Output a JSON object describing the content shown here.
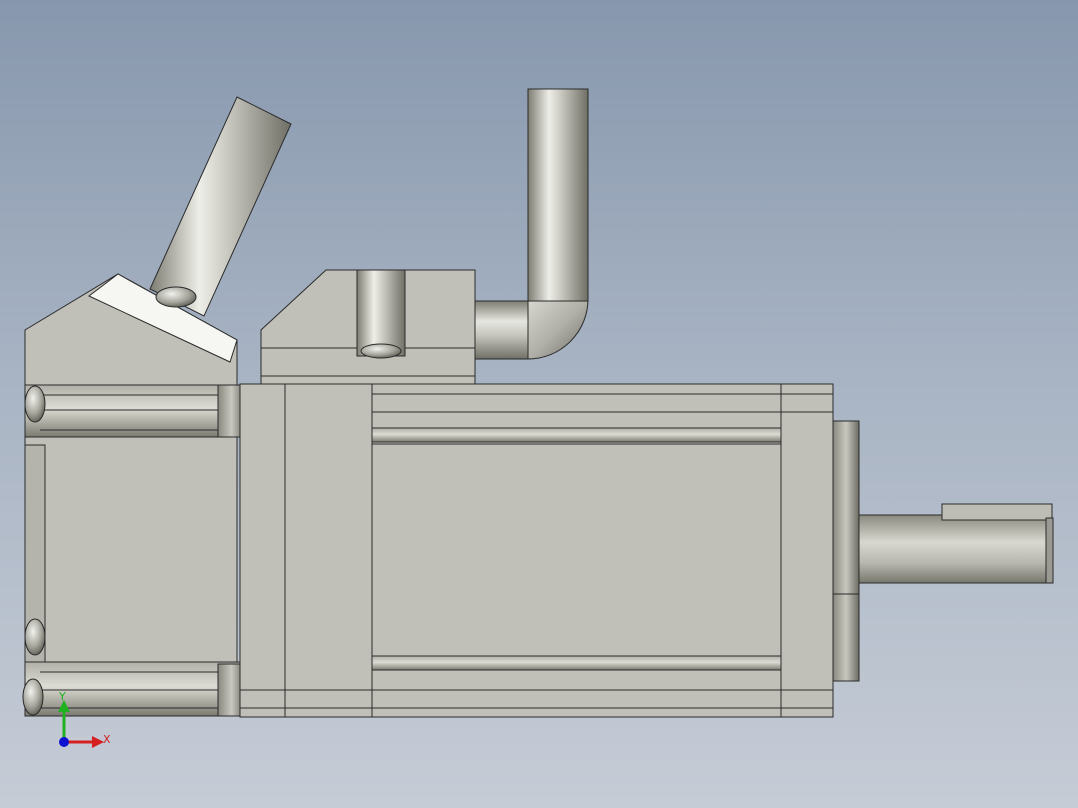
{
  "viewport": {
    "background_top": "#8797ad",
    "background_bottom": "#c6ccd6",
    "model": "servo-motor"
  },
  "triad": {
    "x_label": "X",
    "y_label": "Y",
    "x_color": "#d42020",
    "y_color": "#20b020",
    "origin_color": "#1010d0"
  },
  "colors": {
    "body": "#c0c0b8",
    "edge": "#2a2a2a",
    "highlight": "#f4f4f0",
    "shadow": "#6e6e66"
  }
}
